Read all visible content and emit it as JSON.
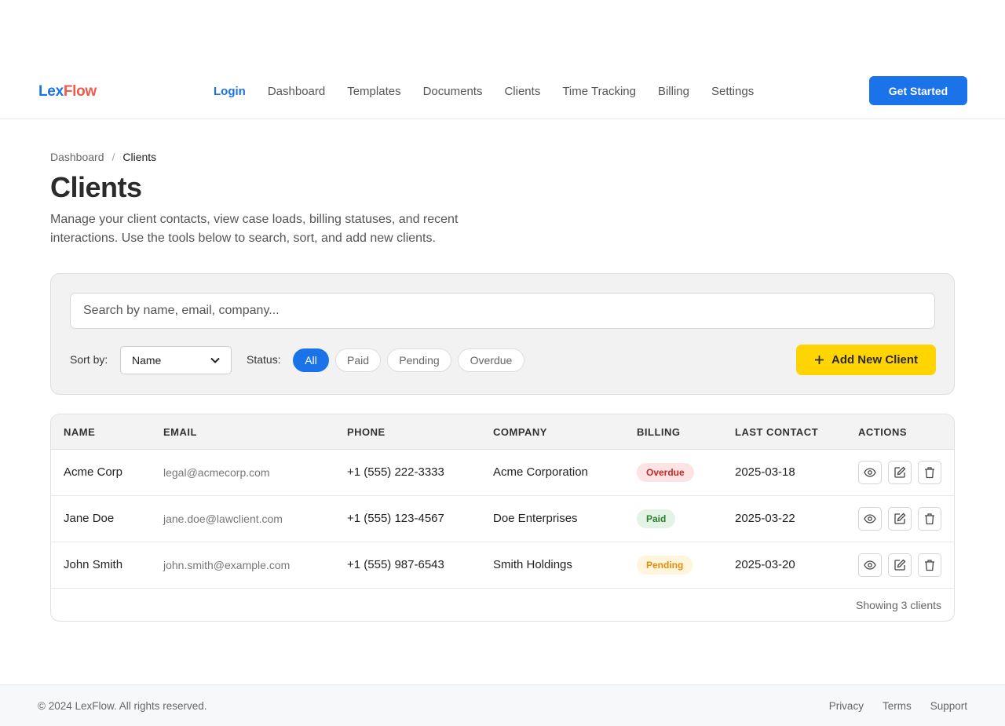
{
  "brand": {
    "part1": "Lex",
    "part2": "Flow"
  },
  "nav": {
    "links": [
      "Login",
      "Dashboard",
      "Templates",
      "Documents",
      "Clients",
      "Time Tracking",
      "Billing",
      "Settings"
    ],
    "active": "Login",
    "cta": "Get Started"
  },
  "breadcrumb": {
    "parent": "Dashboard",
    "separator": "/",
    "current": "Clients"
  },
  "page": {
    "title": "Clients",
    "description": "Manage your client contacts, view case loads, billing statuses, and recent interactions. Use the tools below to search, sort, and add new clients."
  },
  "toolbar": {
    "search_placeholder": "Search by name, email, company...",
    "sort_label": "Sort by:",
    "sort_value": "Name",
    "status_label": "Status:",
    "status_filters": [
      "All",
      "Paid",
      "Pending",
      "Overdue"
    ],
    "status_selected": "All",
    "add_label": "Add New Client"
  },
  "table": {
    "headers": [
      "NAME",
      "EMAIL",
      "PHONE",
      "COMPANY",
      "BILLING",
      "LAST CONTACT",
      "ACTIONS"
    ],
    "rows": [
      {
        "name": "Acme Corp",
        "email": "legal@acmecorp.com",
        "phone": "+1 (555) 222-3333",
        "company": "Acme Corporation",
        "billing": "Overdue",
        "last_contact": "2025-03-18"
      },
      {
        "name": "Jane Doe",
        "email": "jane.doe@lawclient.com",
        "phone": "+1 (555) 123-4567",
        "company": "Doe Enterprises",
        "billing": "Paid",
        "last_contact": "2025-03-22"
      },
      {
        "name": "John Smith",
        "email": "john.smith@example.com",
        "phone": "+1 (555) 987-6543",
        "company": "Smith Holdings",
        "billing": "Pending",
        "last_contact": "2025-03-20"
      }
    ],
    "row_actions": [
      "view-icon",
      "edit-icon",
      "delete-icon"
    ],
    "footer": "Showing 3 clients"
  },
  "footer": {
    "copyright": "© 2024 LexFlow. All rights reserved.",
    "links": [
      "Privacy",
      "Terms",
      "Support"
    ]
  },
  "colors": {
    "primary": "#1a73e8",
    "brand_accent": "#ef5b4b",
    "add_button": "#ffd400",
    "overdue": "#c62828",
    "paid": "#2e7d32",
    "pending": "#e08e0b"
  }
}
